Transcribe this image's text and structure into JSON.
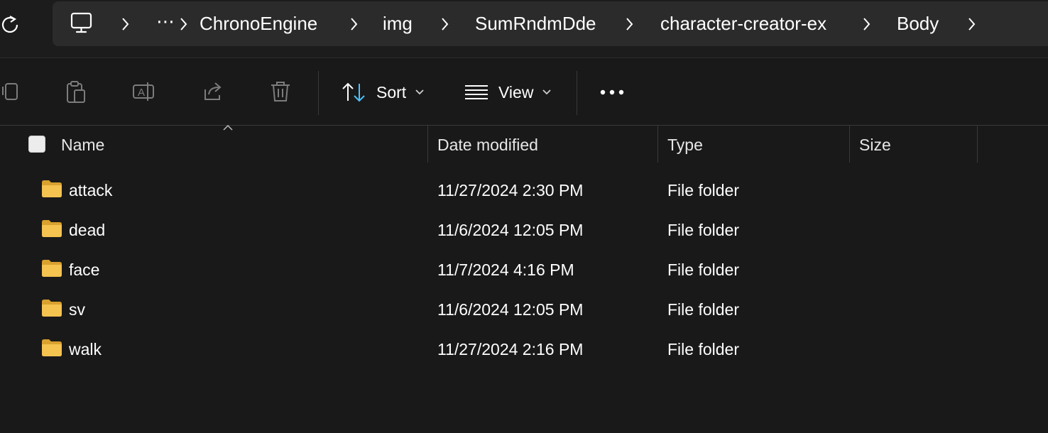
{
  "breadcrumb": {
    "more_label": "⋯",
    "items": [
      "ChronoEngine",
      "img",
      "SumRndmDde",
      "character-creator-ex",
      "Body"
    ]
  },
  "toolbar": {
    "sort_label": "Sort",
    "view_label": "View",
    "icons": [
      "copy-icon",
      "paste-icon",
      "rename-icon",
      "share-icon",
      "delete-icon",
      "sort-icon",
      "view-icon",
      "more-icon"
    ]
  },
  "columns": {
    "name": "Name",
    "date": "Date modified",
    "type": "Type",
    "size": "Size"
  },
  "files": [
    {
      "name": "attack",
      "date": "11/27/2024 2:30 PM",
      "type": "File folder",
      "size": ""
    },
    {
      "name": "dead",
      "date": "11/6/2024 12:05 PM",
      "type": "File folder",
      "size": ""
    },
    {
      "name": "face",
      "date": "11/7/2024 4:16 PM",
      "type": "File folder",
      "size": ""
    },
    {
      "name": "sv",
      "date": "11/6/2024 12:05 PM",
      "type": "File folder",
      "size": ""
    },
    {
      "name": "walk",
      "date": "11/27/2024 2:16 PM",
      "type": "File folder",
      "size": ""
    }
  ],
  "colors": {
    "background": "#191919",
    "address_bar": "#2b2b2b",
    "folder": "#f4c350",
    "accent": "#4cc2ff"
  }
}
